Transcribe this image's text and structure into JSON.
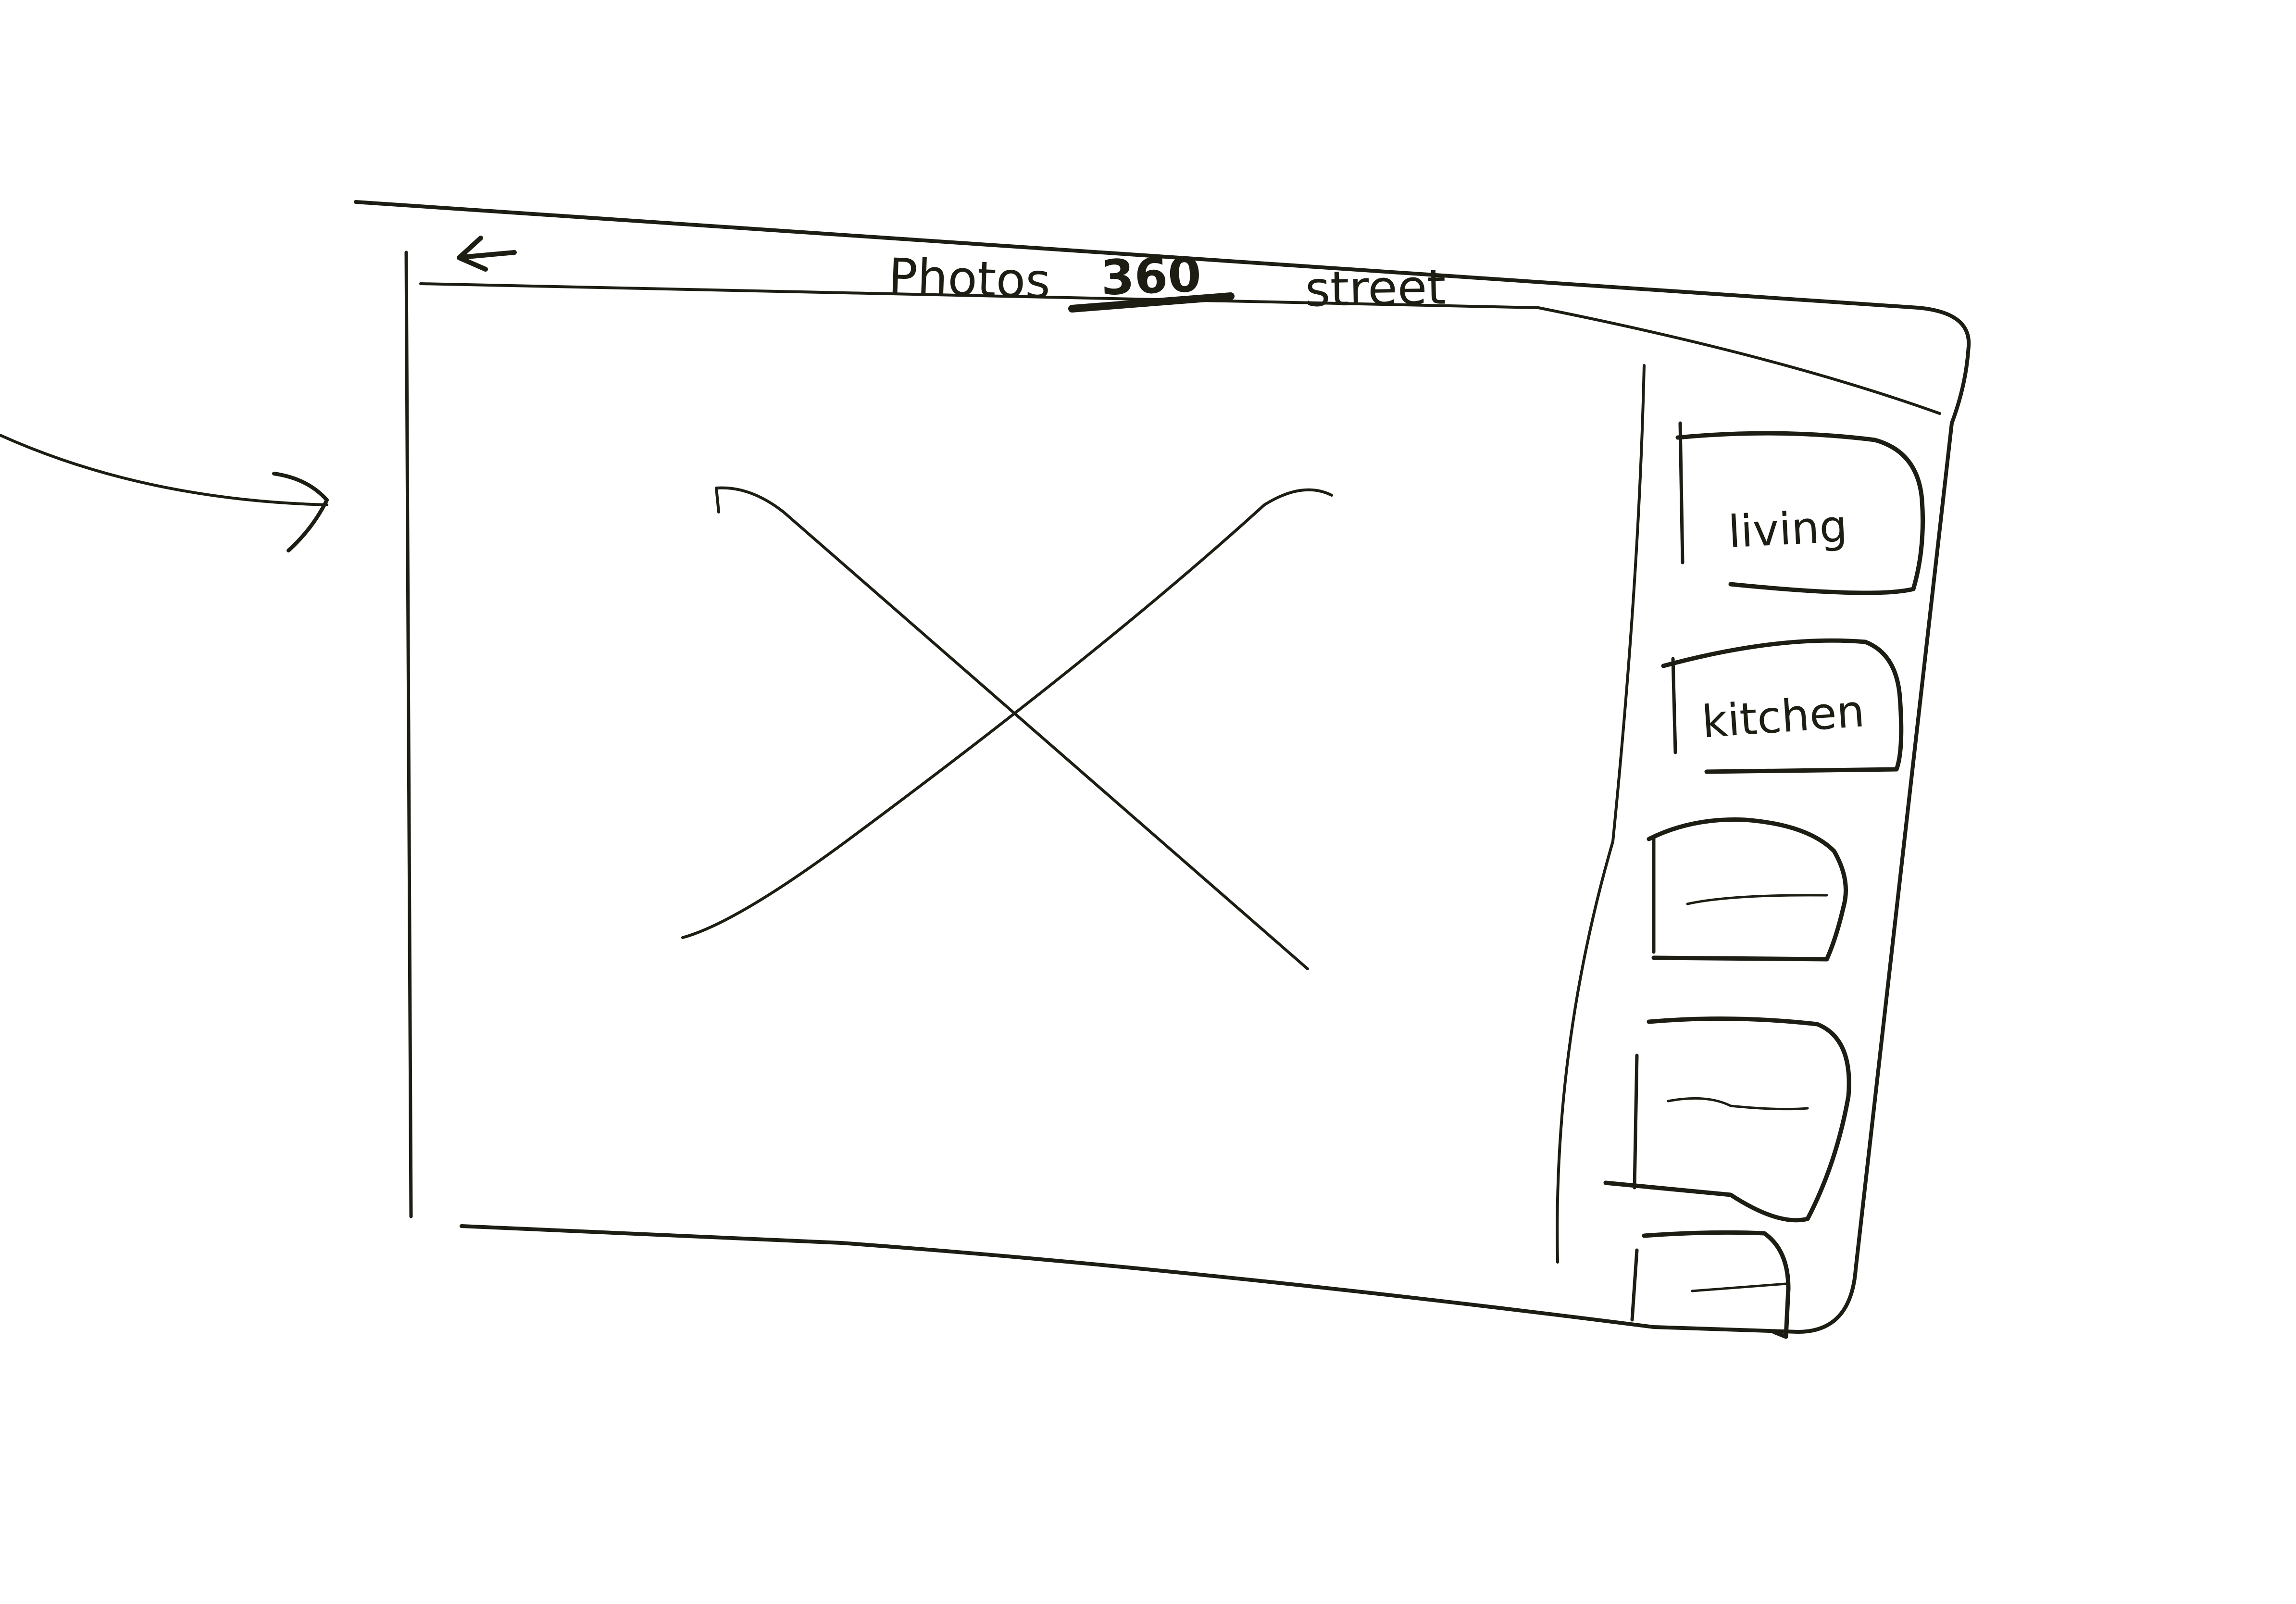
{
  "top_bar": {
    "back_icon": "arrow-left-icon",
    "tabs": [
      {
        "label": "Photos",
        "selected": false
      },
      {
        "label": "360",
        "selected": true
      },
      {
        "label": "street",
        "selected": false
      }
    ]
  },
  "main": {
    "image_placeholder_icon": "image-placeholder-x-icon"
  },
  "sidebar": {
    "thumbnails": [
      {
        "label": "living"
      },
      {
        "label": "kitchen"
      },
      {
        "label": ""
      },
      {
        "label": ""
      },
      {
        "label": ""
      }
    ]
  },
  "annotation": {
    "arrow_icon": "annotation-arrow-icon"
  },
  "colors": {
    "ink": "#1d1d14",
    "paper": "#ffffff"
  }
}
